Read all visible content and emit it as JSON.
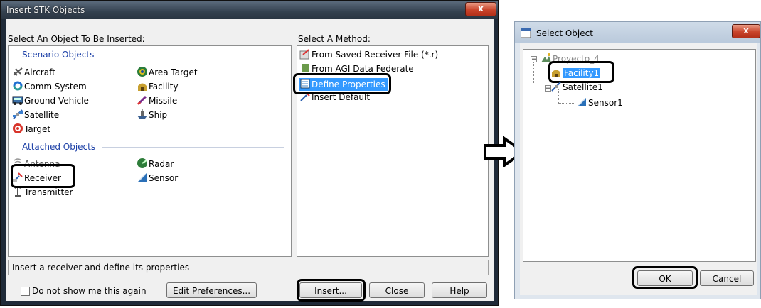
{
  "insert_dialog": {
    "title": "Insert STK Objects",
    "close_glyph": "x",
    "objects_label": "Select An Object To Be Inserted:",
    "scenario_group": "Scenario Objects",
    "scenario_items": [
      "Aircraft",
      "Area Target",
      "Comm System",
      "Facility",
      "Ground Vehicle",
      "Missile",
      "Satellite",
      "Ship",
      "Target"
    ],
    "attached_group": "Attached Objects",
    "attached_items": [
      "Antenna",
      "Radar",
      "Receiver",
      "Sensor",
      "Transmitter"
    ],
    "method_label": "Select A Method:",
    "methods": [
      "From Saved Receiver File (*.r)",
      "From AGI Data Federate",
      "Define Properties",
      "Insert Default"
    ],
    "status_text": "Insert a receiver and define its properties",
    "checkbox_label": "Do not show me this again",
    "edit_preferences_button": "Edit Preferences...",
    "insert_button": "Insert...",
    "close_button": "Close",
    "help_button": "Help"
  },
  "select_dialog": {
    "title": "Select Object",
    "close_glyph": "x",
    "tree": {
      "root": "Proyecto_4",
      "children": [
        "Facility1",
        "Satellite1"
      ],
      "grandchild": "Sensor1"
    },
    "ok_button": "OK",
    "cancel_button": "Cancel"
  }
}
